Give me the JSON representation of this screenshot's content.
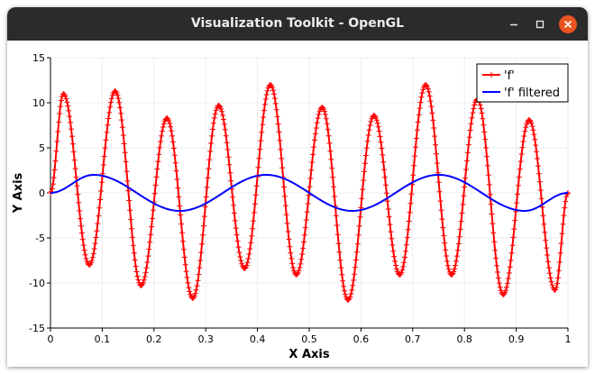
{
  "window": {
    "title": "Visualization Toolkit - OpenGL",
    "controls": {
      "minimize_icon": "minimize-icon",
      "maximize_icon": "maximize-icon",
      "close_icon": "close-icon",
      "close_color": "#e95420"
    }
  },
  "chart_data": {
    "type": "line",
    "xlabel": "X Axis",
    "ylabel": "Y Axis",
    "xlim": [
      0,
      1
    ],
    "ylim": [
      -15,
      15
    ],
    "x_ticks": [
      "0",
      "0.1",
      "0.2",
      "0.3",
      "0.4",
      "0.5",
      "0.6",
      "0.7",
      "0.8",
      "0.9",
      "1"
    ],
    "y_ticks": [
      "15",
      "10",
      "5",
      "0",
      "-5",
      "-10",
      "-15"
    ],
    "grid": true,
    "legend_position": "top-right",
    "series": [
      {
        "name": "'f'",
        "color": "#ff0000",
        "marker": "plus",
        "x": [
          0,
          0.025,
          0.075,
          0.125,
          0.175,
          0.225,
          0.275,
          0.325,
          0.375,
          0.425,
          0.475,
          0.525,
          0.575,
          0.625,
          0.675,
          0.725,
          0.775,
          0.825,
          0.875,
          0.925,
          0.975,
          1
        ],
        "y": [
          0,
          11,
          -8,
          11.3,
          -10.3,
          8.3,
          -11.7,
          9.7,
          -8.4,
          12,
          -9.1,
          9.5,
          -11.9,
          8.6,
          -9.1,
          12,
          -9.1,
          10.4,
          -11.3,
          8.1,
          -10.8,
          0
        ]
      },
      {
        "name": "'f' filtered",
        "color": "#0000ff",
        "marker": "none",
        "x": [
          0,
          0.0833,
          0.25,
          0.4167,
          0.5833,
          0.75,
          0.9167,
          1
        ],
        "y": [
          0,
          2,
          -2,
          2,
          -2,
          2,
          -2,
          0
        ]
      }
    ]
  }
}
